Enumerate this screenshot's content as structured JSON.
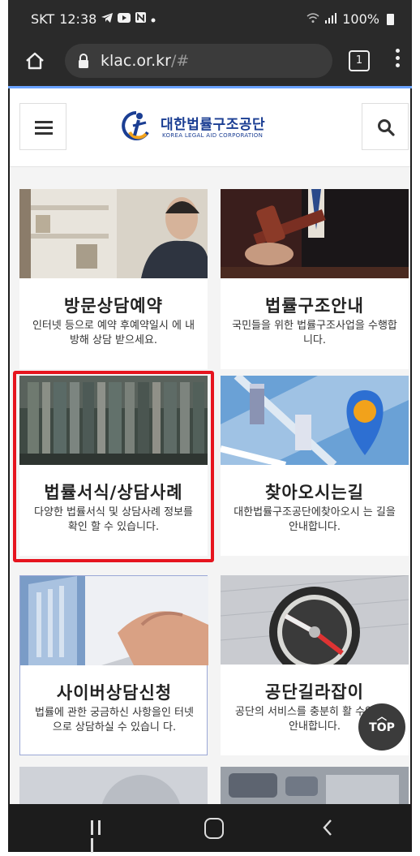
{
  "status_bar": {
    "carrier": "SKT",
    "time": "12:38",
    "notif_icons": [
      "telegram-icon",
      "youtube-icon",
      "n-icon",
      "dot-icon"
    ],
    "battery": "100%"
  },
  "browser": {
    "url_host": "klac.or.kr",
    "url_path": "/#",
    "tab_count": "1"
  },
  "header": {
    "logo_kr": "대한법률구조공단",
    "logo_en": "KOREA LEGAL AID CORPORATION",
    "brand_color": "#1b3e93"
  },
  "cards": [
    {
      "title": "방문상담예약",
      "desc": "인터넷 등으로 예약 후예약일시 에 내방해 상담 받으세요."
    },
    {
      "title": "법률구조안내",
      "desc": "국민들을 위한 법률구조사업을 수행합니다."
    },
    {
      "title": "법률서식/상담사례",
      "desc": "다양한 법률서식 및 상담사례 정보를확인 할 수 있습니다."
    },
    {
      "title": "찾아오시는길",
      "desc": "대한법률구조공단에찾아오시 는 길을 안내합니다."
    },
    {
      "title": "사이버상담신청",
      "desc": "법률에 관한 궁금하신 사항을인 터넷으로 상담하실 수 있습니 다."
    },
    {
      "title": "공단길라잡이",
      "desc": "공단의 서비스를 충분히 활 수있도록 안내합니다."
    }
  ],
  "top_button": {
    "label": "TOP"
  },
  "highlight_color": "#e6141e"
}
